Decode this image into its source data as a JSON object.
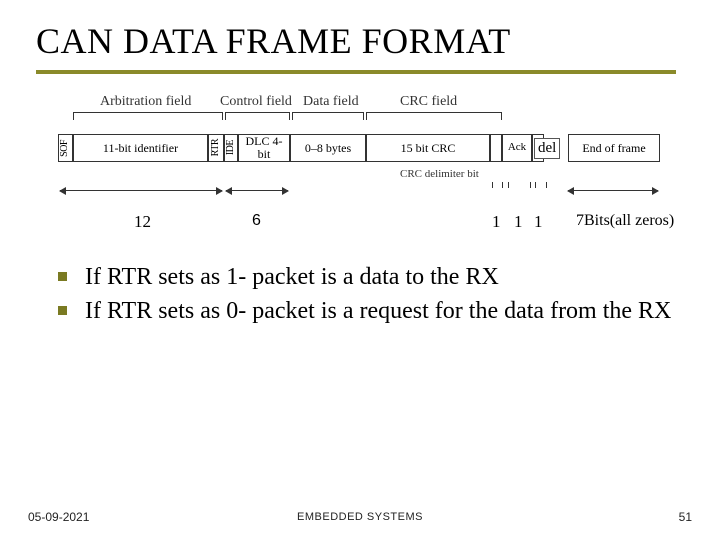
{
  "title": "CAN DATA FRAME FORMAT",
  "diagram": {
    "top_labels": {
      "arbitration": "Arbitration field",
      "control": "Control field",
      "data": "Data field",
      "crc": "CRC field"
    },
    "fields": {
      "sof": "SOF",
      "identifier": "11-bit identifier",
      "rtr": "RTR",
      "ide": "IDE",
      "dlc": "DLC 4-bit",
      "data": "0–8 bytes",
      "crc": "15 bit CRC",
      "ack": "Ack",
      "del": "del",
      "eof": "End of frame"
    },
    "crc_delim_label": "CRC delimiter bit",
    "bit_counts": {
      "arbitration": "12",
      "control": "6",
      "crc_delim": "1",
      "ack": "1",
      "del": "1",
      "eof_note": "7Bits(all zeros)"
    }
  },
  "bullets": [
    "If RTR sets as 1- packet is a data to the RX",
    "If RTR sets as 0- packet is a request for the data from the RX"
  ],
  "footer": {
    "date": "05-09-2021",
    "center": "EMBEDDED SYSTEMS",
    "page": "51"
  }
}
